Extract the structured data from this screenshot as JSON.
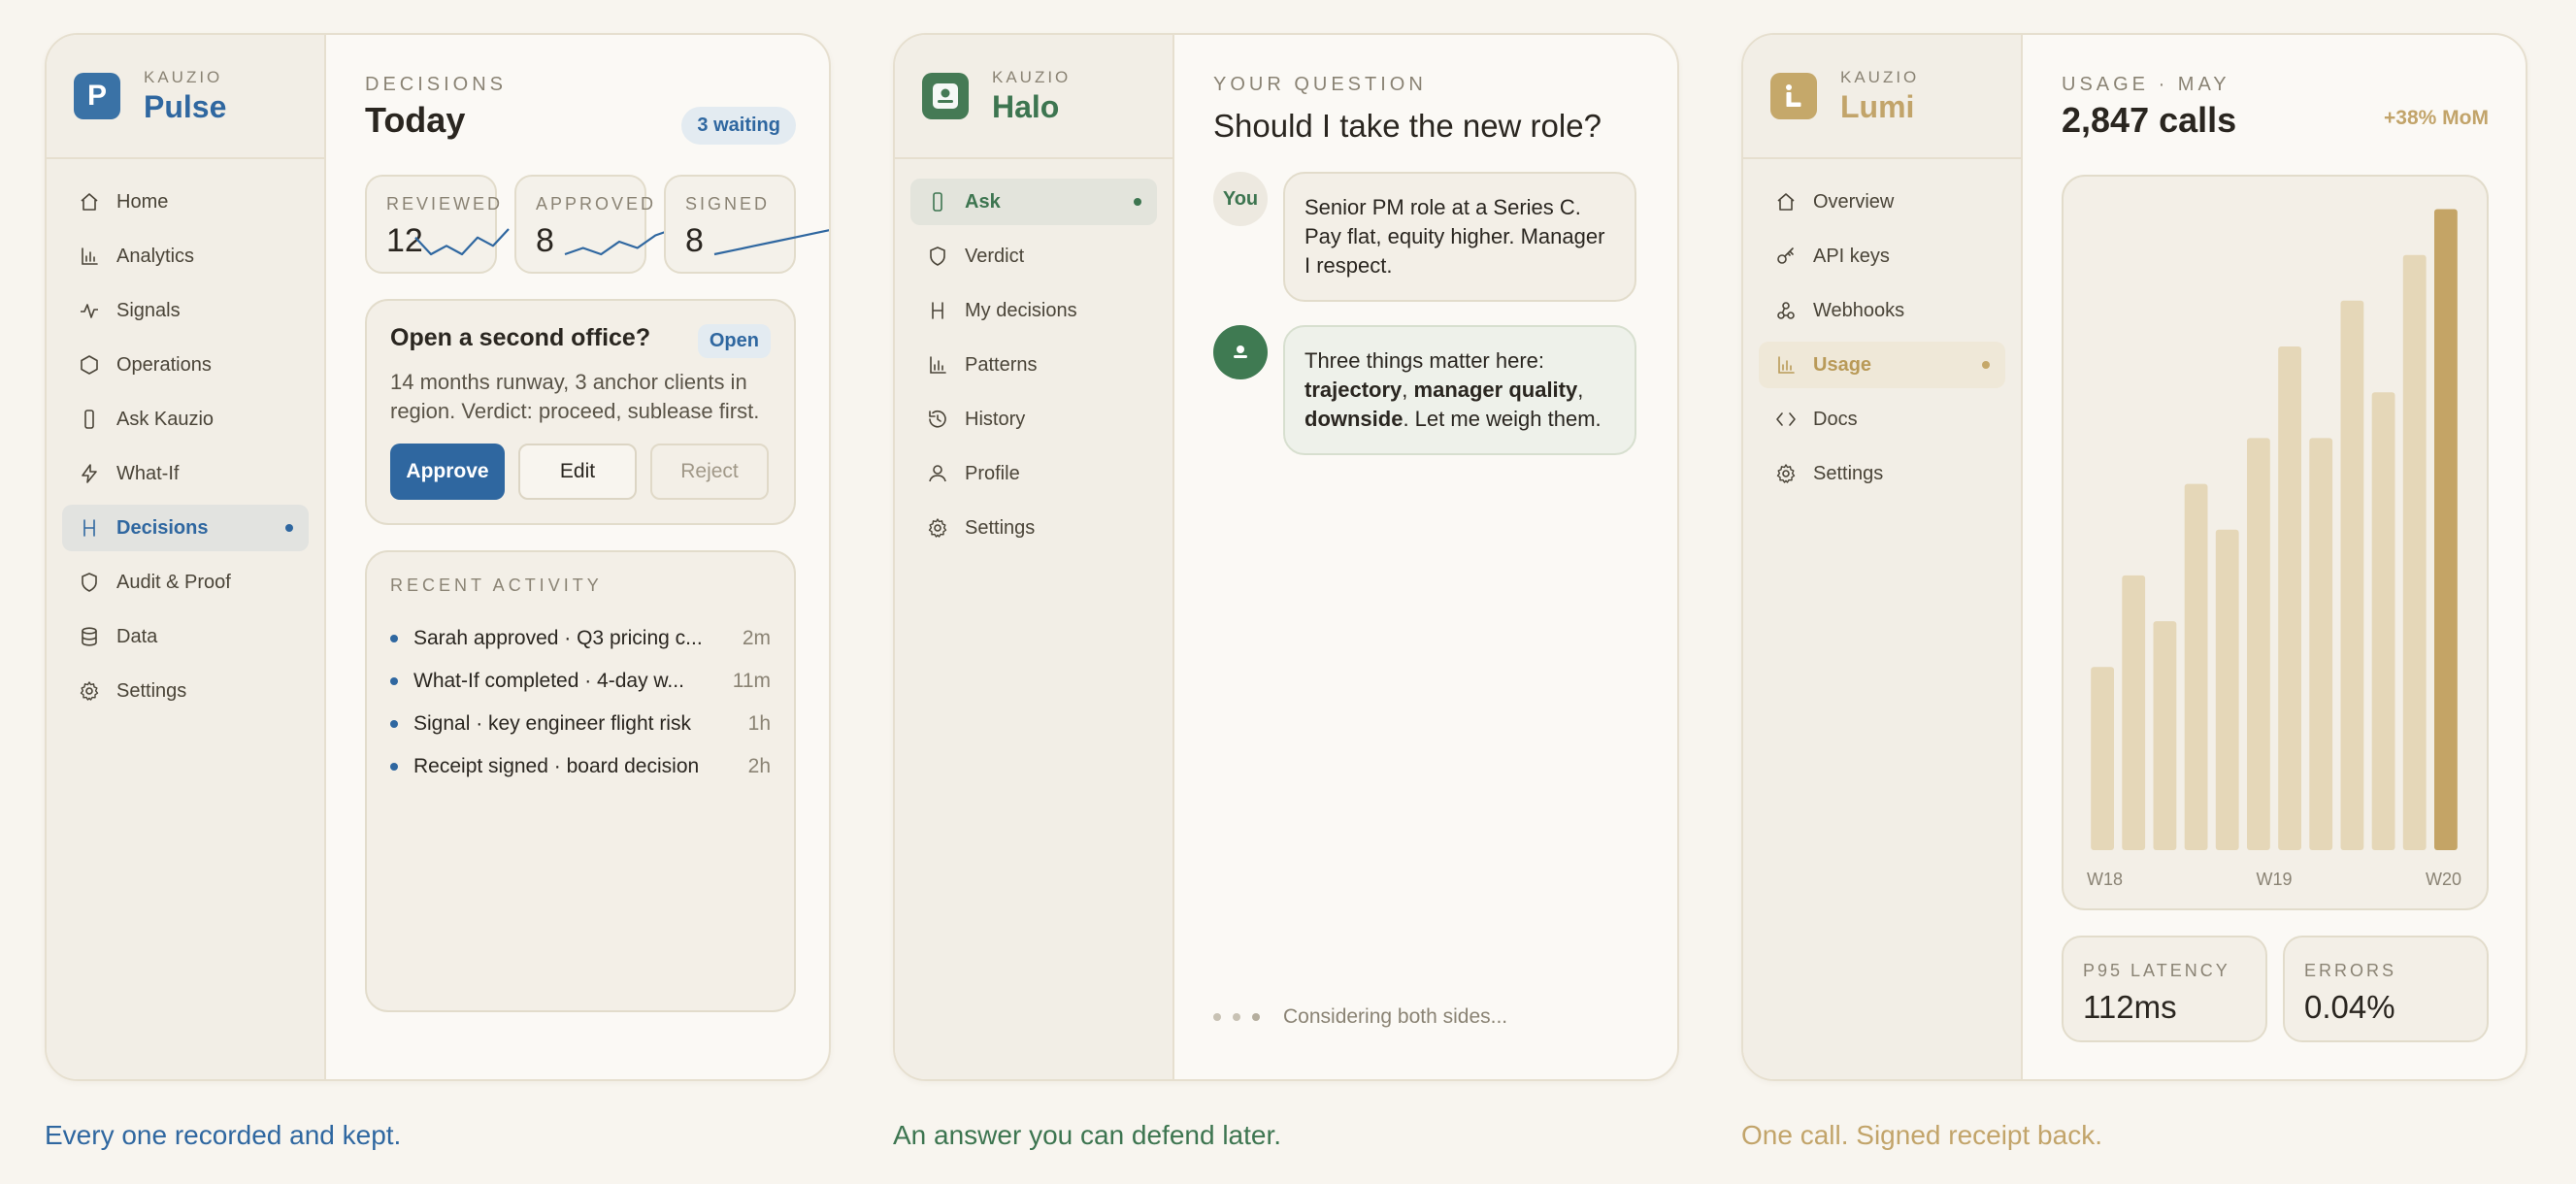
{
  "brand_eyebrow": "KAUZIO",
  "colors": {
    "pulse_accent": "#2f67a0",
    "halo_accent": "#3d7550",
    "lumi_accent": "#c2a46a",
    "background": "#f8f5ef"
  },
  "pulse": {
    "name": "Pulse",
    "logo_letter": "P",
    "nav": [
      {
        "label": "Home",
        "icon": "home-icon"
      },
      {
        "label": "Analytics",
        "icon": "bar-chart-icon"
      },
      {
        "label": "Signals",
        "icon": "pulse-icon"
      },
      {
        "label": "Operations",
        "icon": "hexagon-icon"
      },
      {
        "label": "Ask Kauzio",
        "icon": "phone-icon"
      },
      {
        "label": "What-If",
        "icon": "bolt-icon"
      },
      {
        "label": "Decisions",
        "icon": "decision-icon",
        "active": true
      },
      {
        "label": "Audit & Proof",
        "icon": "shield-icon"
      },
      {
        "label": "Data",
        "icon": "database-icon"
      },
      {
        "label": "Settings",
        "icon": "gear-icon"
      }
    ],
    "eyebrow": "DECISIONS",
    "title": "Today",
    "badge": "3 waiting",
    "stats": [
      {
        "label": "REVIEWED",
        "value": "12",
        "trend": [
          3,
          1,
          2,
          1,
          3,
          2,
          4
        ]
      },
      {
        "label": "APPROVED",
        "value": "8",
        "trend": [
          1,
          2,
          1,
          3,
          2,
          4,
          5
        ]
      },
      {
        "label": "SIGNED",
        "value": "8",
        "trend": [
          0,
          1,
          2,
          3,
          4,
          5,
          6
        ]
      }
    ],
    "card": {
      "title": "Open a second office?",
      "status": "Open",
      "body": "14 months runway, 3 anchor clients in region. Verdict: proceed, sublease first.",
      "approve": "Approve",
      "edit": "Edit",
      "reject": "Reject"
    },
    "activity_title": "RECENT ACTIVITY",
    "activity": [
      {
        "text": "Sarah approved · Q3 pricing c...",
        "time": "2m"
      },
      {
        "text": "What-If completed · 4-day w...",
        "time": "11m"
      },
      {
        "text": "Signal · key engineer flight risk",
        "time": "1h"
      },
      {
        "text": "Receipt signed · board decision",
        "time": "2h"
      }
    ],
    "caption": "Every one recorded and kept."
  },
  "halo": {
    "name": "Halo",
    "nav": [
      {
        "label": "Ask",
        "icon": "phone-icon",
        "active": true
      },
      {
        "label": "Verdict",
        "icon": "shield-icon"
      },
      {
        "label": "My decisions",
        "icon": "decision-icon"
      },
      {
        "label": "Patterns",
        "icon": "bar-chart-icon"
      },
      {
        "label": "History",
        "icon": "history-icon"
      },
      {
        "label": "Profile",
        "icon": "user-icon"
      },
      {
        "label": "Settings",
        "icon": "gear-icon"
      }
    ],
    "eyebrow": "YOUR QUESTION",
    "question": "Should I take the new role?",
    "you_label": "You",
    "user_message": "Senior PM role at a Series C. Pay flat, equity higher. Manager I respect.",
    "ai_message": {
      "intro": "Three things matter here: ",
      "b1": "trajectory",
      "sep1": ", ",
      "b2": "manager quality",
      "sep2": ", ",
      "b3": "downside",
      "outro": ". Let me weigh them."
    },
    "typing": "Considering both sides...",
    "caption": "An answer you can defend later."
  },
  "lumi": {
    "name": "Lumi",
    "logo_letter": "L",
    "nav": [
      {
        "label": "Overview",
        "icon": "home-icon"
      },
      {
        "label": "API keys",
        "icon": "key-icon"
      },
      {
        "label": "Webhooks",
        "icon": "webhook-icon"
      },
      {
        "label": "Usage",
        "icon": "bar-chart-icon",
        "active": true
      },
      {
        "label": "Docs",
        "icon": "code-icon"
      },
      {
        "label": "Settings",
        "icon": "gear-icon"
      }
    ],
    "eyebrow": "USAGE · MAY",
    "title": "2,847 calls",
    "change": "+38% MoM",
    "latency_label": "P95 LATENCY",
    "latency_value": "112ms",
    "errors_label": "ERRORS",
    "errors_value": "0.04%",
    "caption": "One call. Signed receipt back."
  },
  "chart_data": {
    "type": "bar",
    "title": "",
    "xlabel": "",
    "ylabel": "",
    "tick_labels": [
      "W18",
      "W19",
      "W20"
    ],
    "values": [
      28,
      42,
      35,
      56,
      49,
      63,
      77,
      63,
      84,
      70,
      91,
      98
    ],
    "highlight_index": 11,
    "ylim": [
      0,
      100
    ],
    "grid": false
  }
}
